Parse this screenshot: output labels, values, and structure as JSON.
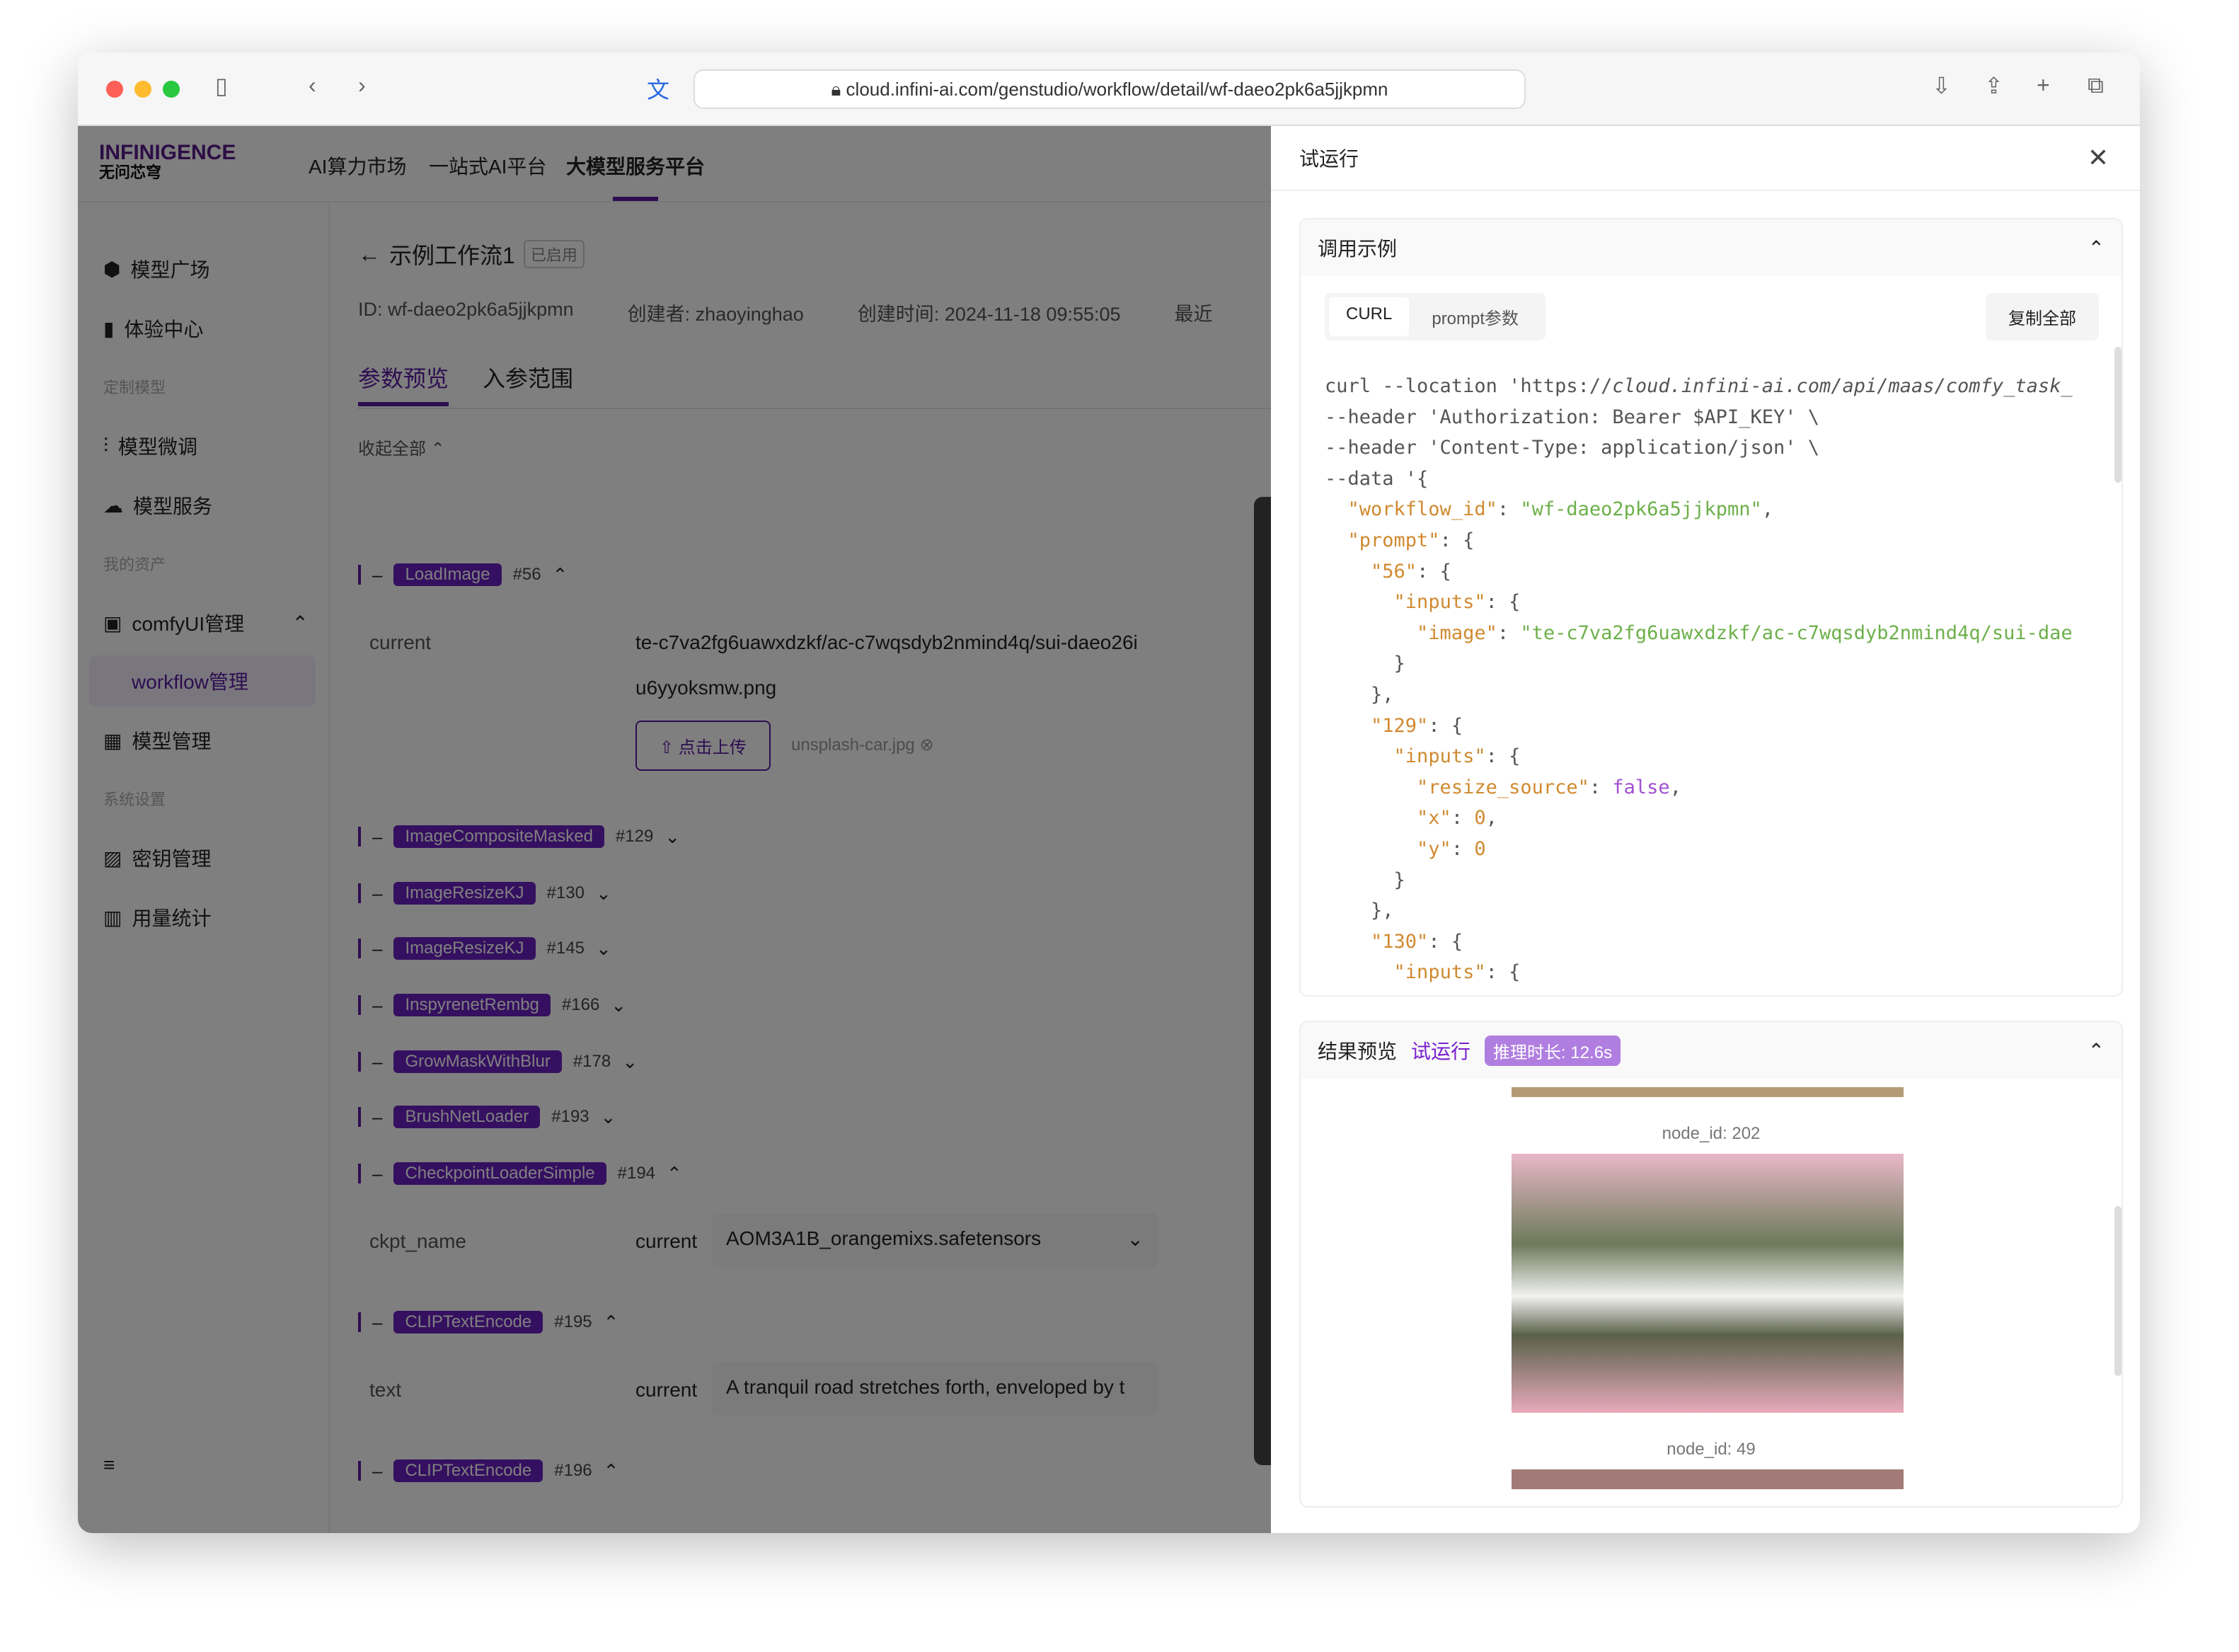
{
  "browser": {
    "url": "cloud.infini-ai.com/genstudio/workflow/detail/wf-daeo2pk6a5jjkpmn"
  },
  "header": {
    "logo": "INFINIGENCE",
    "logo_sub": "无问芯穹",
    "nav": [
      "AI算力市场",
      "一站式AI平台",
      "大模型服务平台"
    ],
    "active_nav": 2
  },
  "sidebar": {
    "items": [
      {
        "label": "模型广场",
        "icon": "cube-icon"
      },
      {
        "label": "体验中心",
        "icon": "device-icon"
      },
      {
        "group": "定制模型"
      },
      {
        "label": "模型微调",
        "icon": "sliders-icon"
      },
      {
        "label": "模型服务",
        "icon": "cloud-icon"
      },
      {
        "group": "我的资产"
      },
      {
        "label": "comfyUI管理",
        "icon": "comfy-icon"
      },
      {
        "label": "workflow管理"
      },
      {
        "label": "模型管理",
        "icon": "grid-icon"
      },
      {
        "group": "系统设置"
      },
      {
        "label": "密钥管理",
        "icon": "key-icon"
      },
      {
        "label": "用量统计",
        "icon": "chart-icon"
      }
    ]
  },
  "workflow": {
    "title": "示例工作流1",
    "status": "已启用",
    "id": "ID: wf-daeo2pk6a5jjkpmn",
    "creator": "创建者: zhaoyinghao",
    "created": "创建时间: 2024-11-18 09:55:05",
    "recent": "最近",
    "tabs": [
      "参数预览",
      "入参范围"
    ],
    "collapse_all": "收起全部",
    "nodes": [
      {
        "name": "LoadImage",
        "id": "#56",
        "expanded": true,
        "field": "current",
        "value": "te-c7va2fg6uawxdzkf/ac-c7wqsdyb2nmind4q/sui-daeo26iu6yyoksmw.png",
        "upload": "点击上传",
        "file": "unsplash-car.jpg"
      },
      {
        "name": "ImageCompositeMasked",
        "id": "#129"
      },
      {
        "name": "ImageResizeKJ",
        "id": "#130"
      },
      {
        "name": "ImageResizeKJ",
        "id": "#145"
      },
      {
        "name": "InspyrenetRembg",
        "id": "#166"
      },
      {
        "name": "GrowMaskWithBlur",
        "id": "#178"
      },
      {
        "name": "BrushNetLoader",
        "id": "#193"
      },
      {
        "name": "CheckpointLoaderSimple",
        "id": "#194",
        "expanded": true,
        "field": "ckpt_name",
        "label": "current",
        "value": "AOM3A1B_orangemixs.safetensors"
      },
      {
        "name": "CLIPTextEncode",
        "id": "#195",
        "expanded": true,
        "field": "text",
        "label": "current",
        "value": "A tranquil road stretches forth, enveloped by t"
      },
      {
        "name": "CLIPTextEncode",
        "id": "#196",
        "expanded": true
      }
    ]
  },
  "panel": {
    "title": "试运行",
    "example": {
      "title": "调用示例",
      "tabs": [
        "CURL",
        "prompt参数"
      ],
      "copy": "复制全部"
    },
    "result": {
      "title": "结果预览",
      "run": "试运行",
      "duration": "推理时长: 12.6s",
      "images": [
        {
          "caption": "node_id: 202"
        },
        {
          "caption": "node_id: 49"
        }
      ]
    }
  },
  "colors": {
    "accent": "#6a20c0"
  }
}
